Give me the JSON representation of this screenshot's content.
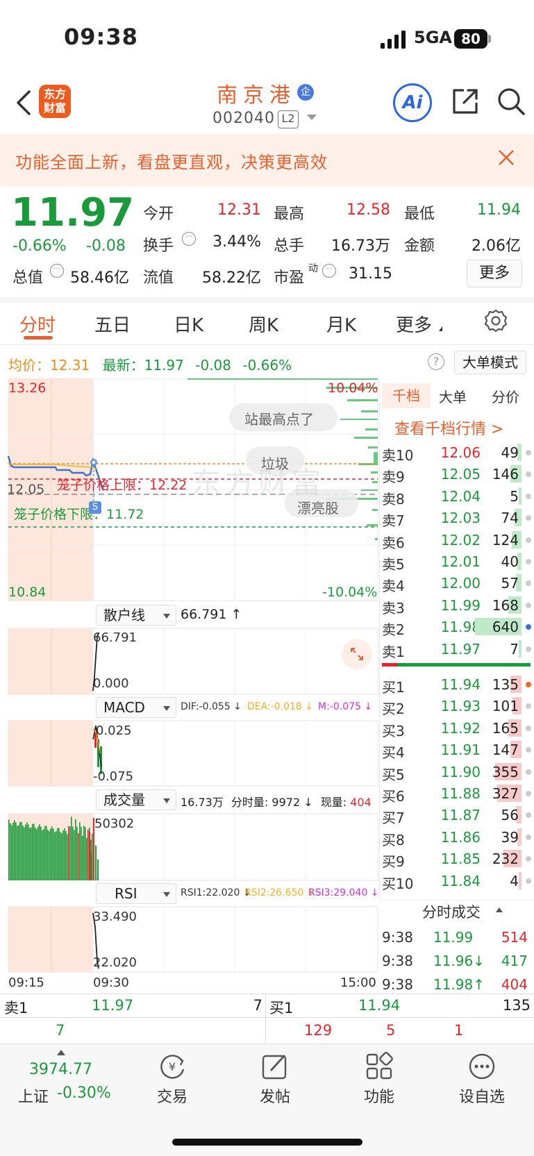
{
  "status_bar": {
    "time": "09:38",
    "network": "5GA",
    "battery": "80"
  },
  "header": {
    "logo_line1": "东方",
    "logo_line2": "财富",
    "stock_name": "南京港",
    "stock_badge": "企",
    "stock_code": "002040",
    "level_badge": "L2",
    "ai_label": "Ai"
  },
  "banner": {
    "text": "功能全面上新，看盘更直观，决策更高效"
  },
  "quote": {
    "price": "11.97",
    "change_pct": "-0.66%",
    "change": "-0.08",
    "open_label": "今开",
    "open": "12.31",
    "high_label": "最高",
    "high": "12.58",
    "low_label": "最低",
    "low": "11.94",
    "turnover_label": "换手",
    "turnover": "3.44%",
    "volume_label": "总手",
    "volume": "16.73万",
    "amount_label": "金额",
    "amount": "2.06亿",
    "mktcap_label": "总值",
    "mktcap": "58.46亿",
    "float_label": "流值",
    "float_cap": "58.22亿",
    "pe_label": "市盈",
    "pe_sup": "动",
    "pe": "31.15",
    "more": "更多"
  },
  "tabs": [
    "分时",
    "五日",
    "日K",
    "周K",
    "月K",
    "更多"
  ],
  "info_line": {
    "avg_label": "均价：",
    "avg": "12.31",
    "latest_label": "最新：",
    "latest": "11.97",
    "latest_chg": "-0.08",
    "latest_pct": "-0.66%",
    "help": "?",
    "big_order_mode": "大单模式"
  },
  "chart": {
    "y_max": "13.26",
    "y_mid": "12.05",
    "y_min": "10.84",
    "pct_max": "10.04%",
    "pct_min": "-10.04%",
    "upper_limit_label": "笼子价格上限：12.22",
    "lower_limit_label": "笼子价格下限：11.72",
    "bubble1": "站最高点了",
    "bubble2": "垃圾",
    "bubble3": "漂亮股",
    "watermark": "东方财富",
    "s_marker": "S",
    "time_start": "09:15",
    "time_mid": "09:30",
    "time_end": "15:00"
  },
  "indicators": {
    "retail": {
      "name": "散户线",
      "value": "66.791 ↑",
      "top": "66.791",
      "bottom": "0.000"
    },
    "macd": {
      "name": "MACD",
      "dif": "DIF:-0.055 ↓",
      "dea": "DEA:-0.018 ↓",
      "m": "M:-0.075 ↓",
      "top": "0.025",
      "bottom": "-0.075"
    },
    "vol": {
      "name": "成交量",
      "summary": "16.73万",
      "split_label": "分时量:",
      "split": "9972 ↓",
      "now_label": "现量:",
      "now": "404",
      "top": "50302"
    },
    "rsi": {
      "name": "RSI",
      "rsi1": "RSI1:22.020 ↓",
      "rsi2": "RSI2:26.650 ↓",
      "rsi3": "RSI3:29.040 ↓",
      "top": "33.490",
      "bottom": "22.020"
    }
  },
  "order_book": {
    "tabs": [
      "千档",
      "大单",
      "分价"
    ],
    "view_link": "查看千档行情 >",
    "asks": [
      {
        "label": "卖10",
        "price": "12.06",
        "vol": "49",
        "bar": 0.04
      },
      {
        "label": "卖9",
        "price": "12.05",
        "vol": "146",
        "bar": 0.1
      },
      {
        "label": "卖8",
        "price": "12.04",
        "vol": "5",
        "bar": 0.02
      },
      {
        "label": "卖7",
        "price": "12.03",
        "vol": "74",
        "bar": 0.06
      },
      {
        "label": "卖6",
        "price": "12.02",
        "vol": "124",
        "bar": 0.09
      },
      {
        "label": "卖5",
        "price": "12.01",
        "vol": "40",
        "bar": 0.04
      },
      {
        "label": "卖4",
        "price": "12.00",
        "vol": "57",
        "bar": 0.05
      },
      {
        "label": "卖3",
        "price": "11.99",
        "vol": "168",
        "bar": 0.12
      },
      {
        "label": "卖2",
        "price": "11.98",
        "vol": "640",
        "bar": 0.42
      },
      {
        "label": "卖1",
        "price": "11.97",
        "vol": "7",
        "bar": 0.02
      }
    ],
    "bids": [
      {
        "label": "买1",
        "price": "11.94",
        "vol": "135",
        "bar": 0.1
      },
      {
        "label": "买2",
        "price": "11.93",
        "vol": "101",
        "bar": 0.08
      },
      {
        "label": "买3",
        "price": "11.92",
        "vol": "165",
        "bar": 0.12
      },
      {
        "label": "买4",
        "price": "11.91",
        "vol": "147",
        "bar": 0.1
      },
      {
        "label": "买5",
        "price": "11.90",
        "vol": "355",
        "bar": 0.24
      },
      {
        "label": "买6",
        "price": "11.88",
        "vol": "327",
        "bar": 0.22
      },
      {
        "label": "买7",
        "price": "11.87",
        "vol": "56",
        "bar": 0.05
      },
      {
        "label": "买8",
        "price": "11.86",
        "vol": "39",
        "bar": 0.04
      },
      {
        "label": "买9",
        "price": "11.85",
        "vol": "232",
        "bar": 0.16
      },
      {
        "label": "买10",
        "price": "11.84",
        "vol": "4",
        "bar": 0.02
      }
    ]
  },
  "time_sales": {
    "title": "分时成交",
    "rows": [
      {
        "time": "9:38",
        "price": "11.99",
        "vol": "514",
        "dir": ""
      },
      {
        "time": "9:38",
        "price": "11.96↓",
        "vol": "417",
        "dir": ""
      },
      {
        "time": "9:38",
        "price": "11.98↑",
        "vol": "404",
        "dir": ""
      }
    ]
  },
  "summary": {
    "ask_label": "卖1",
    "ask_price": "11.97",
    "ask_vol": "7",
    "bid_label": "买1",
    "bid_price": "11.94",
    "bid_vol": "135",
    "left_count": "7",
    "right_a": "129",
    "right_b": "5",
    "right_c": "1"
  },
  "bottom_nav": {
    "index_value": "3974.77",
    "index_label": "上证",
    "index_pct": "-0.30%",
    "items": [
      "交易",
      "发帖",
      "功能",
      "设自选"
    ]
  }
}
